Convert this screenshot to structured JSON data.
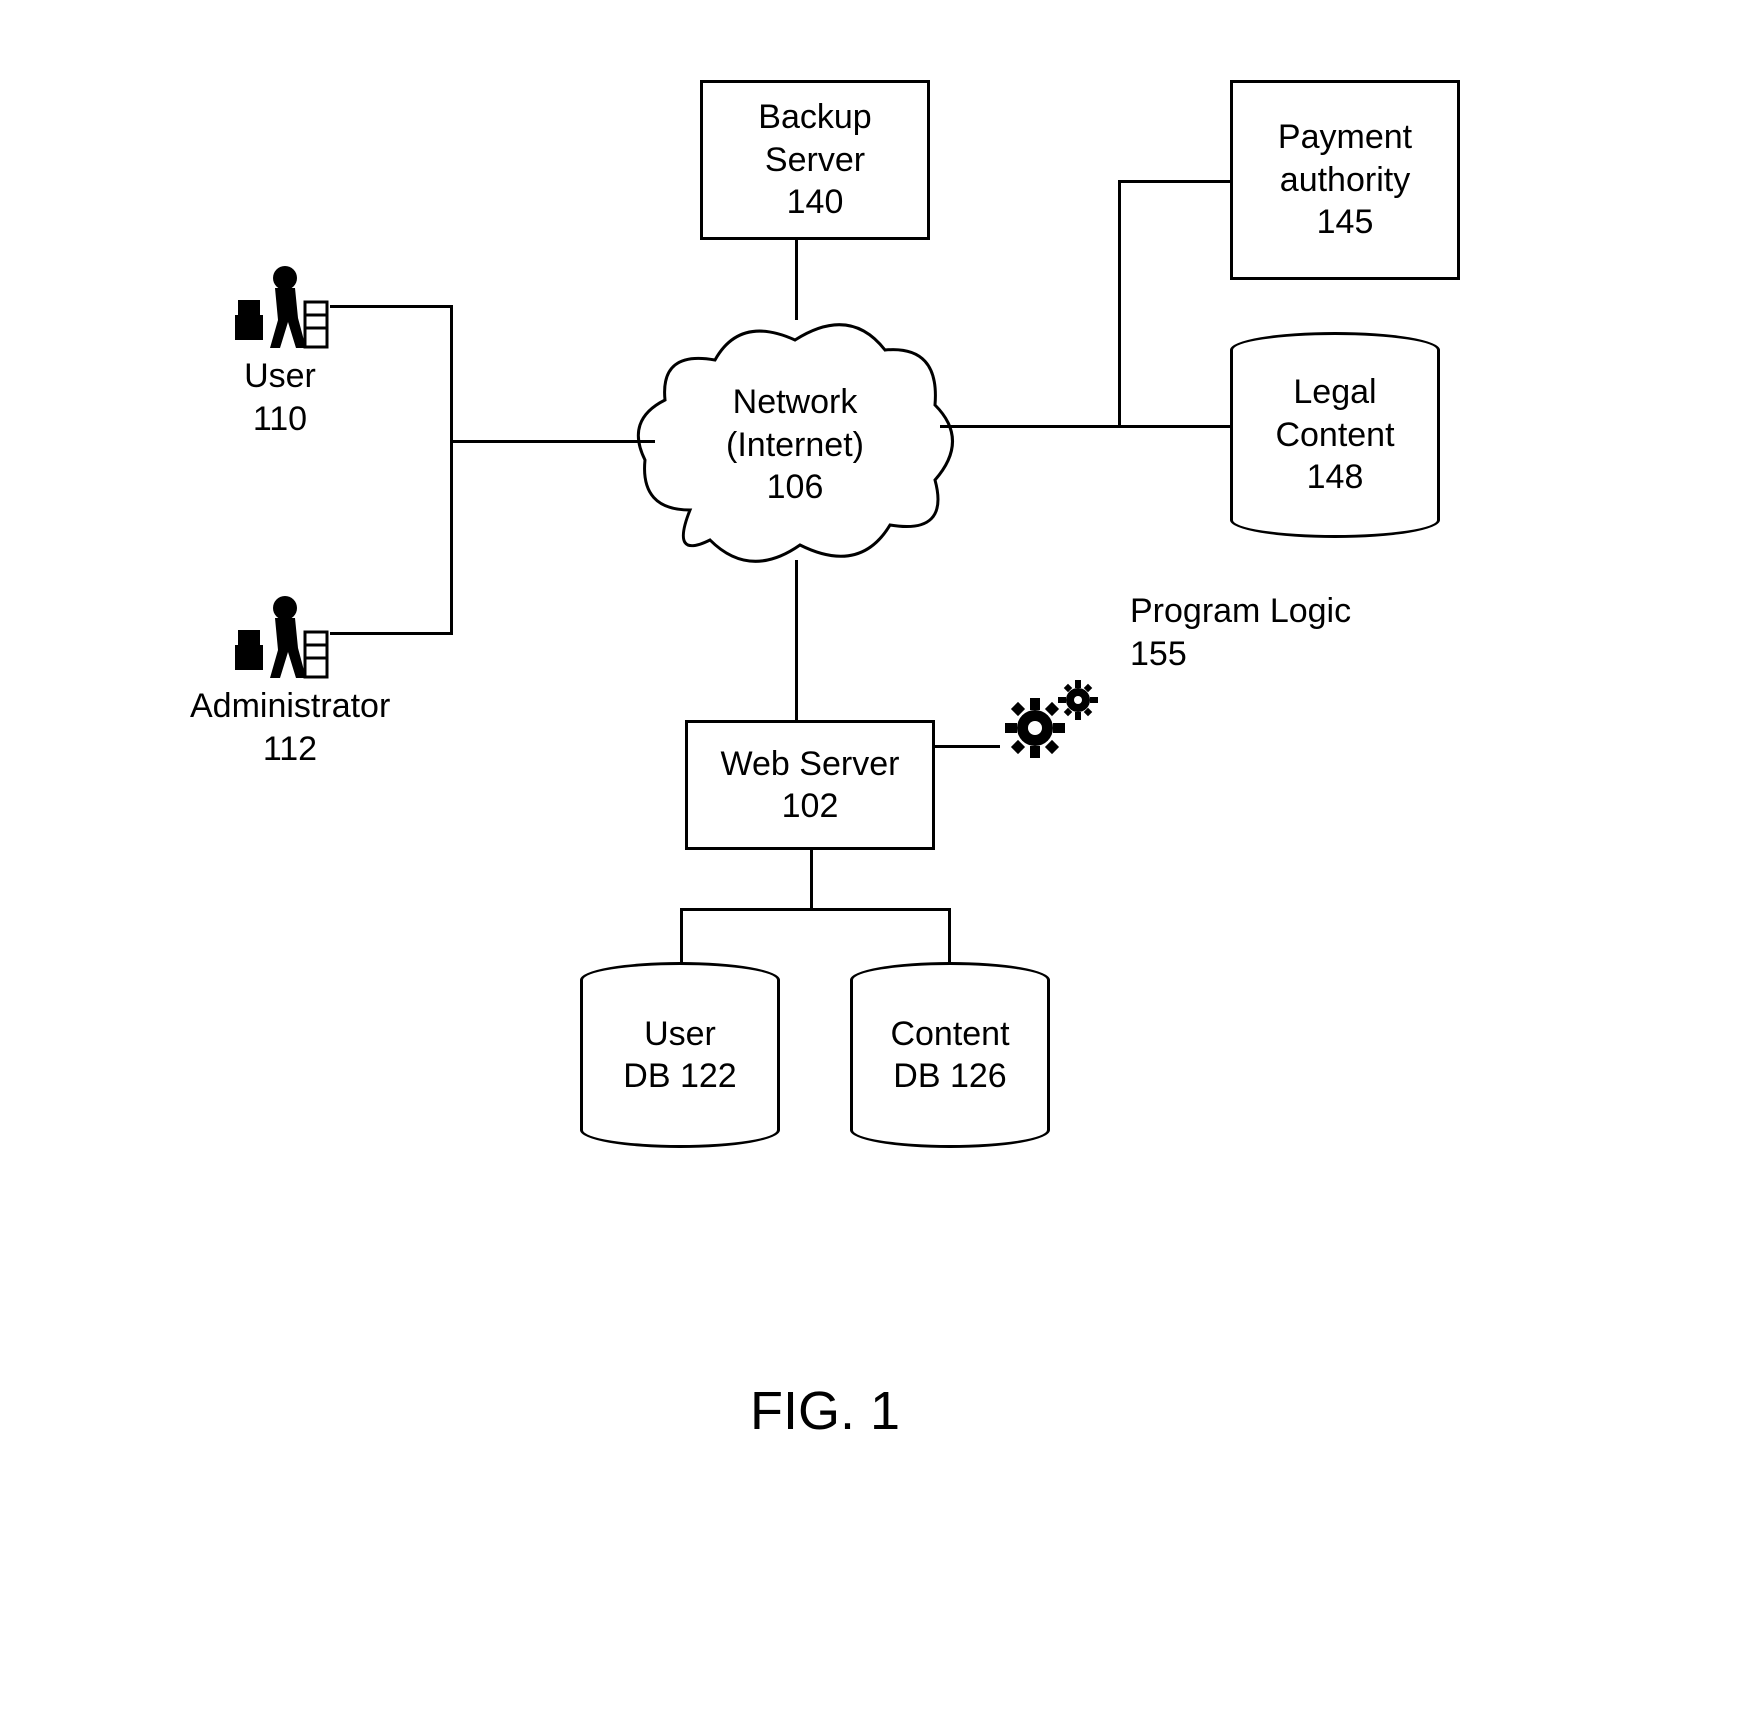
{
  "figure_caption": "FIG. 1",
  "nodes": {
    "user": {
      "label": "User",
      "ref": "110"
    },
    "administrator": {
      "label": "Administrator",
      "ref": "112"
    },
    "backup_server": {
      "label_line1": "Backup",
      "label_line2": "Server",
      "ref": "140"
    },
    "network": {
      "label_line1": "Network",
      "label_line2": "(Internet)",
      "ref": "106"
    },
    "payment_authority": {
      "label_line1": "Payment",
      "label_line2": "authority",
      "ref": "145"
    },
    "legal_content": {
      "label_line1": "Legal",
      "label_line2": "Content",
      "ref": "148"
    },
    "web_server": {
      "label": "Web Server",
      "ref": "102"
    },
    "program_logic": {
      "label": "Program Logic",
      "ref": "155"
    },
    "user_db": {
      "label_line1": "User",
      "label_line2": "DB 122"
    },
    "content_db": {
      "label_line1": "Content",
      "label_line2": "DB 126"
    }
  }
}
